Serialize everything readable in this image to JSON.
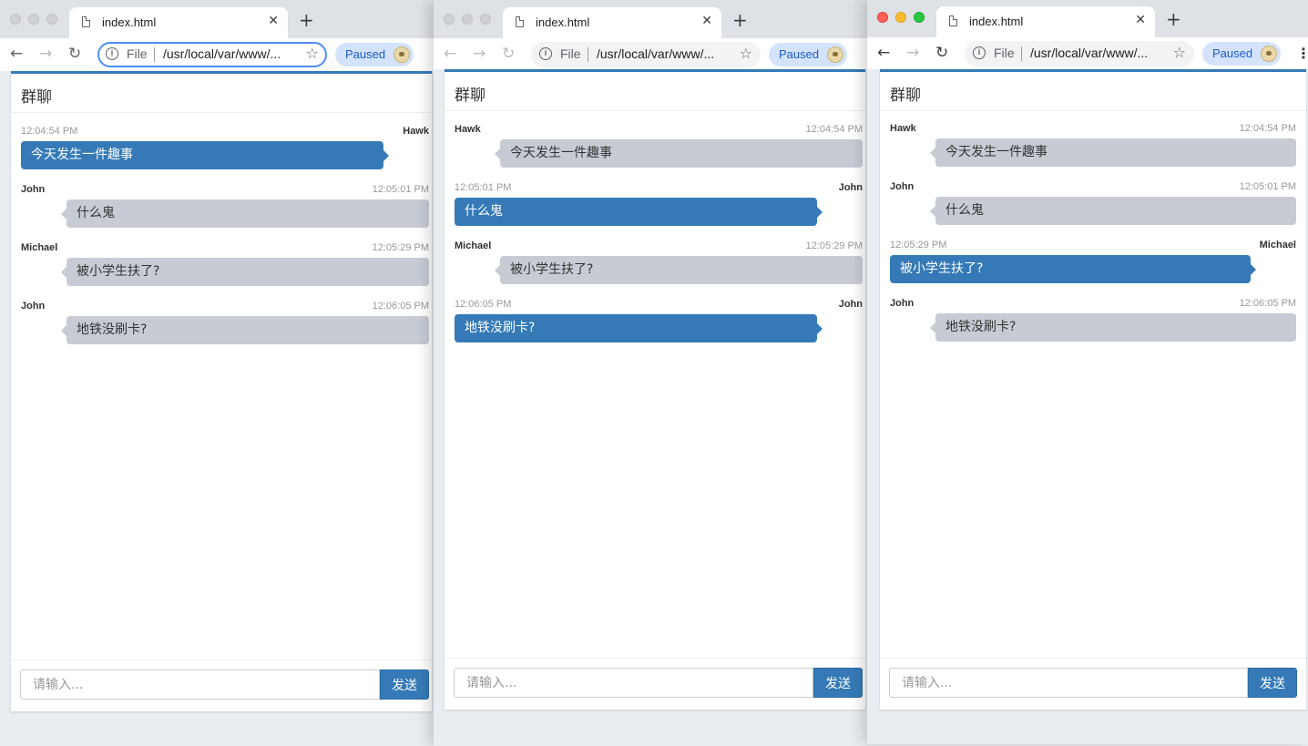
{
  "chrome": {
    "tab_title": "index.html",
    "tab_close": "✕",
    "new_tab": "+",
    "omnibox_scheme": "File",
    "omnibox_url": "/usr/local/var/www/...",
    "paused_label": "Paused",
    "back": "←",
    "forward": "→",
    "reload": "↻",
    "star": "☆",
    "menu": "⋮"
  },
  "chat": {
    "title": "群聊",
    "input_placeholder": "请输入...",
    "send_label": "发送"
  },
  "windows": [
    {
      "state": "inactive",
      "omnibox_focused": true,
      "messages": [
        {
          "sender": "Hawk",
          "time": "12:04:54 PM",
          "text": "今天发生一件趣事",
          "self": true
        },
        {
          "sender": "John",
          "time": "12:05:01 PM",
          "text": "什么鬼",
          "self": false
        },
        {
          "sender": "Michael",
          "time": "12:05:29 PM",
          "text": "被小学生扶了?",
          "self": false
        },
        {
          "sender": "John",
          "time": "12:06:05 PM",
          "text": "地铁没刷卡?",
          "self": false
        }
      ]
    },
    {
      "state": "inactive",
      "omnibox_focused": false,
      "messages": [
        {
          "sender": "Hawk",
          "time": "12:04:54 PM",
          "text": "今天发生一件趣事",
          "self": false
        },
        {
          "sender": "John",
          "time": "12:05:01 PM",
          "text": "什么鬼",
          "self": true
        },
        {
          "sender": "Michael",
          "time": "12:05:29 PM",
          "text": "被小学生扶了?",
          "self": false
        },
        {
          "sender": "John",
          "time": "12:06:05 PM",
          "text": "地铁没刷卡?",
          "self": true
        }
      ]
    },
    {
      "state": "active",
      "omnibox_focused": false,
      "messages": [
        {
          "sender": "Hawk",
          "time": "12:04:54 PM",
          "text": "今天发生一件趣事",
          "self": false
        },
        {
          "sender": "John",
          "time": "12:05:01 PM",
          "text": "什么鬼",
          "self": false
        },
        {
          "sender": "Michael",
          "time": "12:05:29 PM",
          "text": "被小学生扶了?",
          "self": true
        },
        {
          "sender": "John",
          "time": "12:06:05 PM",
          "text": "地铁没刷卡?",
          "self": false
        }
      ]
    }
  ],
  "colors": {
    "primary": "#357ab7",
    "bubble_other": "#c7cbd4",
    "tabstrip": "#dee1e6",
    "paused_chip": "#d4e3fb"
  },
  "icons": {
    "tab": "file-icon",
    "info": "info-icon",
    "star": "star-icon",
    "avatar": "profile-avatar-icon"
  }
}
